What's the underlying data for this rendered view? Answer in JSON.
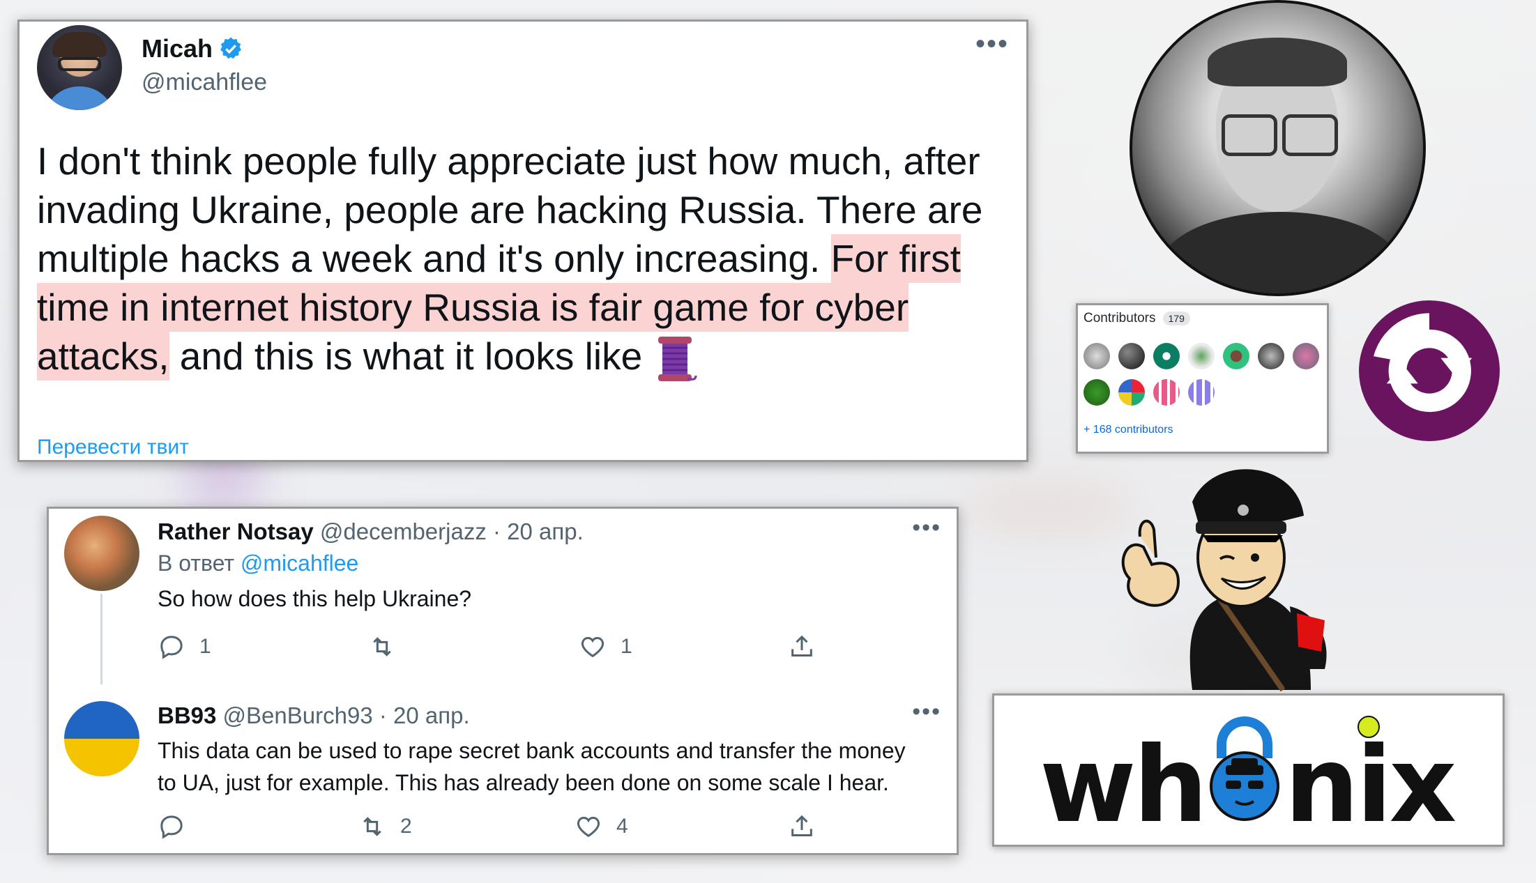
{
  "main_tweet": {
    "author_name": "Micah",
    "handle": "@micahflee",
    "text_part1": "I don't think people fully appreciate just how much, after invading Ukraine, people are hacking Russia. There are multiple hacks a week and it's only increasing. ",
    "text_highlight": "For first time in internet history Russia is fair game for cyber attacks,",
    "text_part2": " and this is what it looks like ",
    "translate_label": "Перевести твит",
    "more_label": "•••"
  },
  "replies": [
    {
      "author_name": "Rather Notsay",
      "handle": "@decemberjazz",
      "date": "· 20 апр.",
      "reply_to_prefix": "В ответ",
      "reply_to_handle": "@micahflee",
      "text": "So how does this help Ukraine?",
      "reply_count": "1",
      "retweet_count": "",
      "like_count": "1",
      "more_label": "•••"
    },
    {
      "author_name": "BB93",
      "handle": "@BenBurch93",
      "date": "· 20 апр.",
      "text_line1": "This data can be used to rape secret bank accounts and transfer the money",
      "text_line2": "to UA, just for example.  This has already been done on some scale I hear.",
      "reply_count": "",
      "retweet_count": "2",
      "like_count": "4",
      "more_label": "•••"
    }
  ],
  "contributors": {
    "title": "Contributors",
    "count": "179",
    "more_link": "+ 168 contributors"
  },
  "colors": {
    "twitter_blue": "#1d9bf0",
    "highlight": "#fbd3d3",
    "sync_purple": "#6a1460",
    "whonix_lock_blue": "#1e7fd6",
    "whonix_dot": "#d7ec1e"
  },
  "icons": {
    "verified": "verified-badge-icon",
    "spool": "thread-spool-icon",
    "reply": "reply-icon",
    "retweet": "retweet-icon",
    "like": "heart-icon",
    "share": "share-icon",
    "sync": "sync-logo-icon",
    "lock": "lock-logo-icon"
  },
  "whonix_logo": {
    "part1": "wh",
    "part2": "nix"
  }
}
